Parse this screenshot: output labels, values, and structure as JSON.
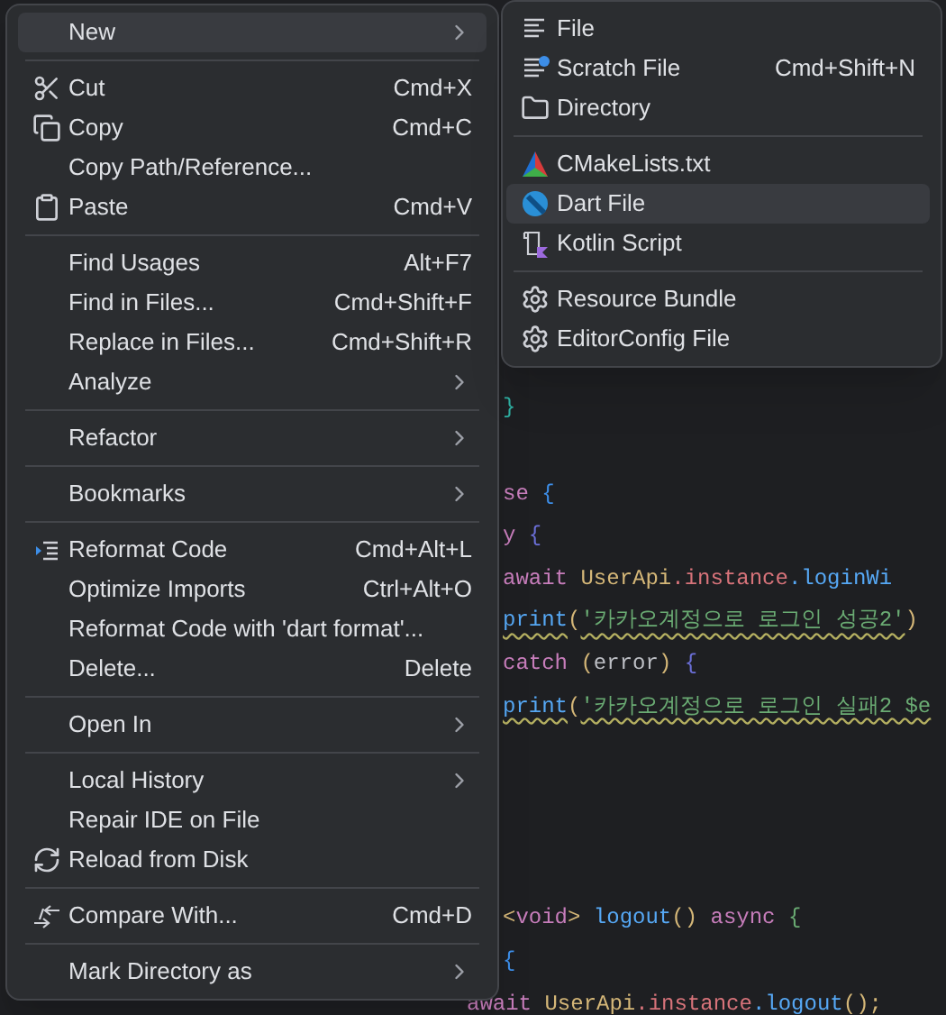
{
  "editor": {
    "lines": [
      {
        "kind": "blank"
      },
      {
        "kind": "blank"
      },
      {
        "kind": "blank"
      },
      {
        "kind": "blank"
      },
      {
        "kind": "blank"
      },
      {
        "kind": "blank"
      },
      {
        "kind": "blank"
      },
      {
        "kind": "blank"
      },
      {
        "kind": "blank"
      },
      {
        "kind": "code",
        "tokens": [
          {
            "text": "}",
            "color": "#2fb3a5"
          }
        ]
      },
      {
        "kind": "blank"
      },
      {
        "kind": "code",
        "tokens": [
          {
            "text": "se ",
            "color": "#c77dbb"
          },
          {
            "text": "{",
            "color": "#3d8ee8"
          }
        ]
      },
      {
        "kind": "code",
        "tokens": [
          {
            "text": "y ",
            "color": "#c77dbb"
          },
          {
            "text": "{",
            "color": "#6b6fd8"
          }
        ]
      },
      {
        "kind": "code",
        "tokens": [
          {
            "text": "await ",
            "color": "#c77dbb"
          },
          {
            "text": "UserApi",
            "color": "#d5b778"
          },
          {
            "text": ".instance",
            "color": "#d7737a"
          },
          {
            "text": ".loginWi",
            "color": "#56a8f5"
          }
        ]
      },
      {
        "kind": "code",
        "tokens": [
          {
            "text": "print",
            "color": "#56a8f5",
            "squiggly": true
          },
          {
            "text": "(",
            "color": "#d5b778"
          },
          {
            "text": "'카카오계정으로 로그인 성공2'",
            "color": "#6aab73",
            "squiggly": true
          },
          {
            "text": ")",
            "color": "#d5b778"
          }
        ]
      },
      {
        "kind": "code",
        "tokens": [
          {
            "text": "catch ",
            "color": "#c77dbb"
          },
          {
            "text": "(",
            "color": "#d5b778"
          },
          {
            "text": "error",
            "color": "#bcbec4"
          },
          {
            "text": ") ",
            "color": "#d5b778"
          },
          {
            "text": "{",
            "color": "#6b6fd8"
          }
        ]
      },
      {
        "kind": "code",
        "tokens": [
          {
            "text": "print",
            "color": "#56a8f5",
            "squiggly": true
          },
          {
            "text": "(",
            "color": "#d5b778"
          },
          {
            "text": "'카카오계정으로 로그인 실패2 $e",
            "color": "#6aab73",
            "squiggly": true
          }
        ]
      },
      {
        "kind": "blank"
      },
      {
        "kind": "blank"
      },
      {
        "kind": "blank"
      },
      {
        "kind": "blank"
      },
      {
        "kind": "code",
        "tokens": [
          {
            "text": "<",
            "color": "#d5b778"
          },
          {
            "text": "void",
            "color": "#c77dbb"
          },
          {
            "text": "> ",
            "color": "#d5b778"
          },
          {
            "text": "logout",
            "color": "#56a8f5"
          },
          {
            "text": "() ",
            "color": "#d5b778"
          },
          {
            "text": "async ",
            "color": "#c77dbb"
          },
          {
            "text": "{",
            "color": "#6aab73"
          }
        ]
      },
      {
        "kind": "code",
        "tokens": [
          {
            "text": "{",
            "color": "#3d8ee8"
          }
        ]
      },
      {
        "kind": "code",
        "tokens": [
          {
            "text": "await ",
            "color": "#c77dbb"
          },
          {
            "text": "UserApi",
            "color": "#d5b778"
          },
          {
            "text": ".instance",
            "color": "#d7737a"
          },
          {
            "text": ".logout",
            "color": "#56a8f5"
          },
          {
            "text": "();",
            "color": "#d5b778"
          }
        ],
        "outdent": true
      }
    ]
  },
  "context_menu": {
    "items": [
      {
        "kind": "item",
        "label": "New",
        "submenu": true,
        "selected": true
      },
      {
        "kind": "separator"
      },
      {
        "kind": "item",
        "label": "Cut",
        "shortcut": "Cmd+X",
        "selected": false
      },
      {
        "kind": "item",
        "label": "Copy",
        "shortcut": "Cmd+C",
        "selected": false
      },
      {
        "kind": "item",
        "label": "Copy Path/Reference...",
        "selected": false
      },
      {
        "kind": "item",
        "label": "Paste",
        "shortcut": "Cmd+V",
        "selected": false
      },
      {
        "kind": "separator"
      },
      {
        "kind": "item",
        "label": "Find Usages",
        "shortcut": "Alt+F7",
        "selected": false
      },
      {
        "kind": "item",
        "label": "Find in Files...",
        "shortcut": "Cmd+Shift+F",
        "selected": false
      },
      {
        "kind": "item",
        "label": "Replace in Files...",
        "shortcut": "Cmd+Shift+R",
        "selected": false
      },
      {
        "kind": "item",
        "label": "Analyze",
        "submenu": true,
        "selected": false
      },
      {
        "kind": "separator"
      },
      {
        "kind": "item",
        "label": "Refactor",
        "submenu": true,
        "selected": false
      },
      {
        "kind": "separator"
      },
      {
        "kind": "item",
        "label": "Bookmarks",
        "submenu": true,
        "selected": false
      },
      {
        "kind": "separator"
      },
      {
        "kind": "item",
        "label": "Reformat Code",
        "shortcut": "Cmd+Alt+L",
        "selected": false
      },
      {
        "kind": "item",
        "label": "Optimize Imports",
        "shortcut": "Ctrl+Alt+O",
        "selected": false
      },
      {
        "kind": "item",
        "label": "Reformat Code with 'dart format'...",
        "selected": false
      },
      {
        "kind": "item",
        "label": "Delete...",
        "shortcut": "Delete",
        "selected": false
      },
      {
        "kind": "separator"
      },
      {
        "kind": "item",
        "label": "Open In",
        "submenu": true,
        "selected": false
      },
      {
        "kind": "separator"
      },
      {
        "kind": "item",
        "label": "Local History",
        "submenu": true,
        "selected": false
      },
      {
        "kind": "item",
        "label": "Repair IDE on File",
        "selected": false
      },
      {
        "kind": "item",
        "label": "Reload from Disk",
        "selected": false
      },
      {
        "kind": "separator"
      },
      {
        "kind": "item",
        "label": "Compare With...",
        "shortcut": "Cmd+D",
        "selected": false
      },
      {
        "kind": "separator"
      },
      {
        "kind": "item",
        "label": "Mark Directory as",
        "submenu": true,
        "selected": false
      }
    ]
  },
  "new_submenu": {
    "items": [
      {
        "kind": "item",
        "label": "File",
        "selected": false
      },
      {
        "kind": "item",
        "label": "Scratch File",
        "shortcut": "Cmd+Shift+N",
        "selected": false
      },
      {
        "kind": "item",
        "label": "Directory",
        "selected": false
      },
      {
        "kind": "separator"
      },
      {
        "kind": "item",
        "label": "CMakeLists.txt",
        "selected": false
      },
      {
        "kind": "item",
        "label": "Dart File",
        "selected": true
      },
      {
        "kind": "item",
        "label": "Kotlin Script",
        "selected": false
      },
      {
        "kind": "separator"
      },
      {
        "kind": "item",
        "label": "Resource Bundle",
        "selected": false
      },
      {
        "kind": "item",
        "label": "EditorConfig File",
        "selected": false
      }
    ]
  }
}
